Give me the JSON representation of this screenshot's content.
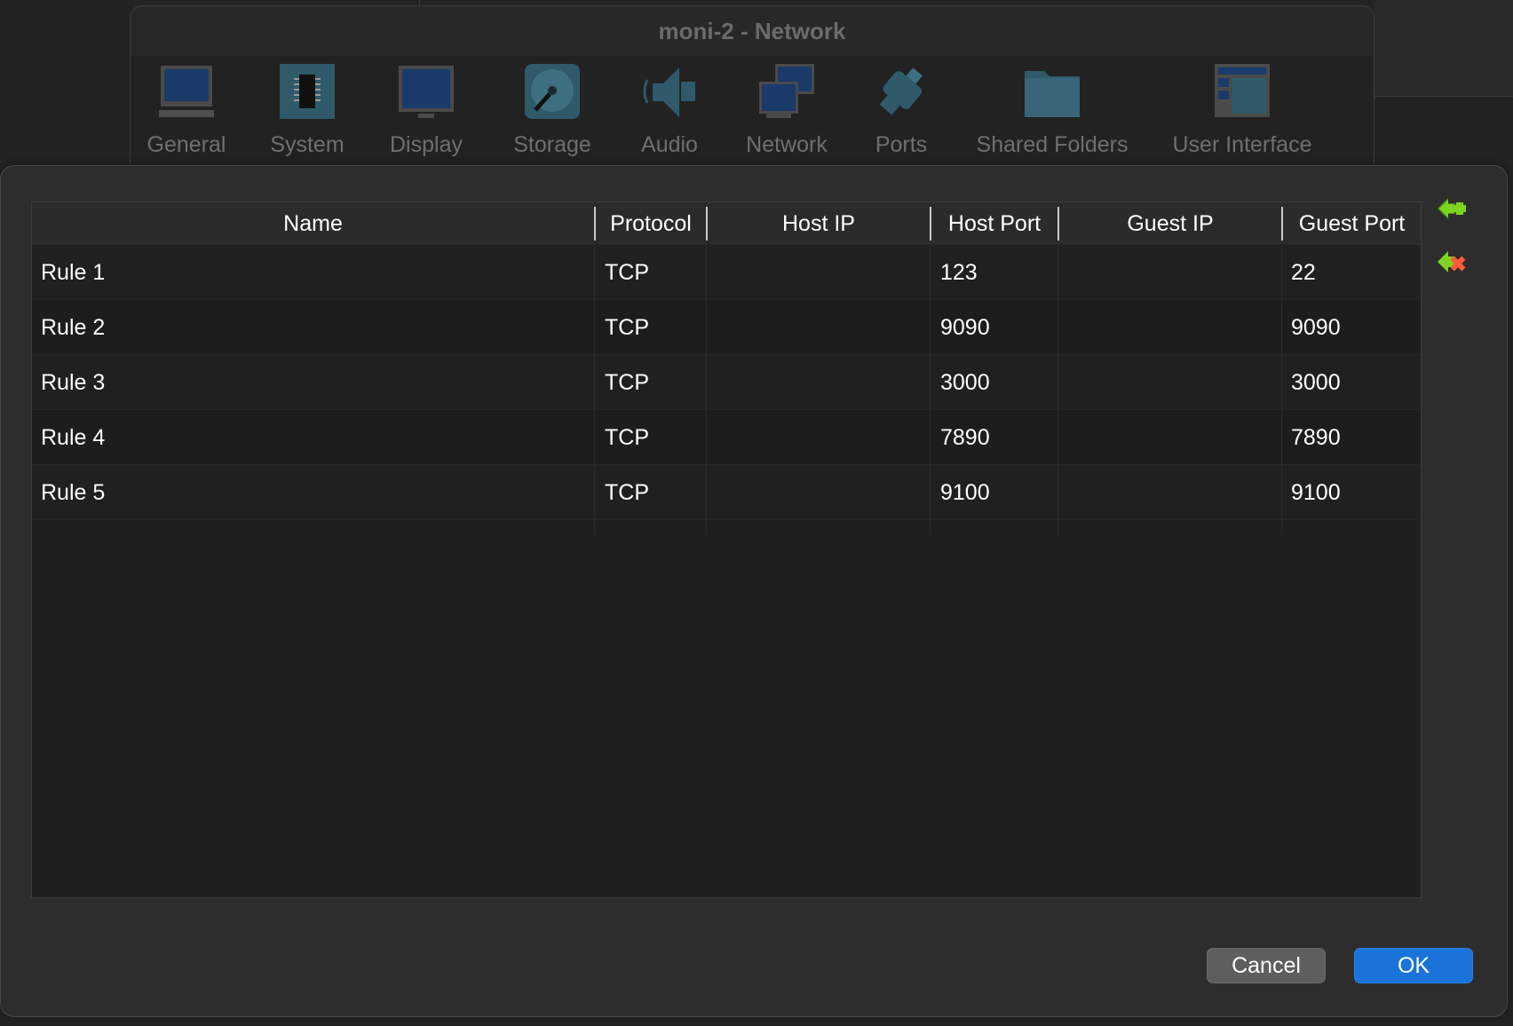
{
  "window": {
    "title": "moni-2 - Network"
  },
  "toolbar": {
    "items": [
      {
        "label": "General",
        "icon": "general-icon"
      },
      {
        "label": "System",
        "icon": "system-chip-icon"
      },
      {
        "label": "Display",
        "icon": "display-monitor-icon"
      },
      {
        "label": "Storage",
        "icon": "storage-disk-icon"
      },
      {
        "label": "Audio",
        "icon": "audio-speaker-icon"
      },
      {
        "label": "Network",
        "icon": "network-icon"
      },
      {
        "label": "Ports",
        "icon": "ports-connector-icon"
      },
      {
        "label": "Shared Folders",
        "icon": "shared-folder-icon"
      },
      {
        "label": "User Interface",
        "icon": "user-interface-icon"
      }
    ]
  },
  "table": {
    "columns": [
      "Name",
      "Protocol",
      "Host IP",
      "Host Port",
      "Guest IP",
      "Guest Port"
    ],
    "rows": [
      {
        "name": "Rule 1",
        "protocol": "TCP",
        "host_ip": "",
        "host_port": "123",
        "guest_ip": "",
        "guest_port": "22"
      },
      {
        "name": "Rule 2",
        "protocol": "TCP",
        "host_ip": "",
        "host_port": "9090",
        "guest_ip": "",
        "guest_port": "9090"
      },
      {
        "name": "Rule 3",
        "protocol": "TCP",
        "host_ip": "",
        "host_port": "3000",
        "guest_ip": "",
        "guest_port": "3000"
      },
      {
        "name": "Rule 4",
        "protocol": "TCP",
        "host_ip": "",
        "host_port": "7890",
        "guest_ip": "",
        "guest_port": "7890"
      },
      {
        "name": "Rule 5",
        "protocol": "TCP",
        "host_ip": "",
        "host_port": "9100",
        "guest_ip": "",
        "guest_port": "9100"
      }
    ]
  },
  "side_buttons": {
    "add_icon": "add-rule-icon",
    "remove_icon": "remove-rule-icon"
  },
  "buttons": {
    "cancel": "Cancel",
    "ok": "OK"
  },
  "colors": {
    "accent": "#1a73d9",
    "add_green": "#7ed321",
    "remove_red": "#ff5a3c"
  }
}
